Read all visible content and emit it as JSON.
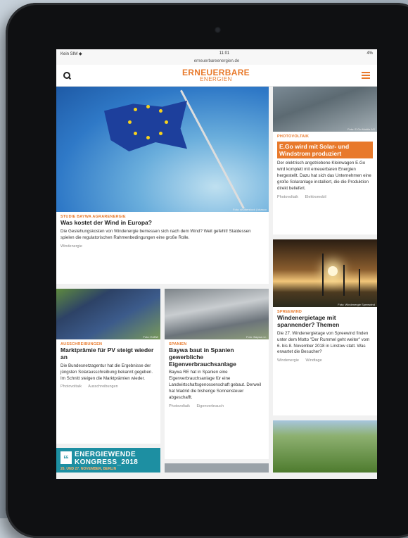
{
  "status": {
    "left": "Kein SIM ◆",
    "time": "11:01",
    "right": "4%"
  },
  "url": "erneuerbareenergien.de",
  "logo": {
    "line1": "ERNEUERBARE",
    "line2": "ENERGIEN"
  },
  "articles": {
    "main": {
      "credit": "Foto: shutterstock | kbaaco",
      "kicker": "Studie Baywa Agrarenergie",
      "title": "Was kostet der Wind in Europa?",
      "teaser": "Die Gestehungskosten von Windenergie bemessen sich nach dem Wind? Weit gefehlt! Statdessen spielen die regulatorischen Rahmenbedingungen eine große Rolle.",
      "tag1": "Windenergie"
    },
    "rt1": {
      "credit": "Foto: E.Go Mobile AG",
      "kicker": "Photovoltaik",
      "title": "E.Go wird mit Solar- und Windstrom produziert",
      "teaser": "Der elektrisch angetriebene Kleinwagen E.Go wird komplett mit erneuerbaren Energien hergestellt. Dazu hat sich das Unternehmen eine große Solaranlage installiert, die die Produktion direkt beliefert.",
      "tag1": "Photovoltaik",
      "tag2": "Elektromobil"
    },
    "rt2": {
      "credit": "Foto: Windenergie Spreewind",
      "kicker": "Spreewind",
      "title": "Windenergietage mit spannender? Themen",
      "teaser": "Die 27. Windenergietage von Spreewind finden unter dem Motto \"Der Rummel geht weiter\" vom 6. bis 8. November 2018 in Linstow statt. Was erwartet die Besucher?",
      "tag1": "Windenergie",
      "tag2": "Windtage"
    },
    "l1": {
      "credit": "Foto: EnBW",
      "kicker": "Ausschreibungen",
      "title": "Marktprämie für PV steigt wieder an",
      "teaser": "Die Bundesnetzagentur hat die Ergebnisse der jüngsten Solarausschreibung bekannt gegeben. Im Schnitt steigen die Marktprämien wieder.",
      "tag1": "Photovoltaik",
      "tag2": "Ausschreibungen"
    },
    "l2": {
      "credit": "Foto: Baywa r.e.",
      "kicker": "Spanien",
      "title": "Baywa baut in Spanien gewerbliche Eigenverbrauchsanlage",
      "teaser": "Baywa RE hat in Spanien eine Eigenverbrauchsanlage für eine Landwirtschaftsgenossenschaft gebaut. Derweil hat Madrid die bisherige Sonnensteuer abgeschafft.",
      "tag1": "Photovoltaik",
      "tag2": "Eigenverbrauch"
    }
  },
  "banner": {
    "badge": "EE",
    "line1": "ENERGIEWENDE",
    "line2": "KONGRESS_2018",
    "line3": "26. UND 27. NOVEMBER, BERLIN"
  }
}
